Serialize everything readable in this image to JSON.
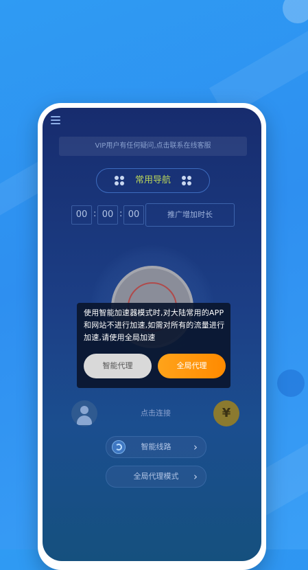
{
  "colors": {
    "background": "#2f9bf3",
    "accent_orange": "#ff9a1a",
    "nav_text": "#b9d45a"
  },
  "menu": {
    "icon": "hamburger-menu-icon"
  },
  "notice": {
    "text": "VIP用户有任何疑问,点击联系在线客服"
  },
  "nav": {
    "label": "常用导航",
    "left_icon": "clover-icon",
    "right_icon": "clover-icon"
  },
  "timer": {
    "hours": "00",
    "minutes": "00",
    "seconds": "00",
    "sep": ":"
  },
  "extend_button": {
    "label": "推广增加时长"
  },
  "dialog": {
    "message": "使用智能加速器模式时,对大陆常用的APP和网站不进行加速,如需对所有的流量进行加速,请使用全局加速",
    "smart_button": "智能代理",
    "global_button": "全局代理"
  },
  "bottom": {
    "avatar_icon": "user-avatar-icon",
    "connect_label": "点击连接",
    "yuan_symbol": "¥",
    "route_label": "智能线路",
    "route_icon": "route-globe-icon",
    "mode_label": "全局代理模式",
    "chevron": "›"
  }
}
